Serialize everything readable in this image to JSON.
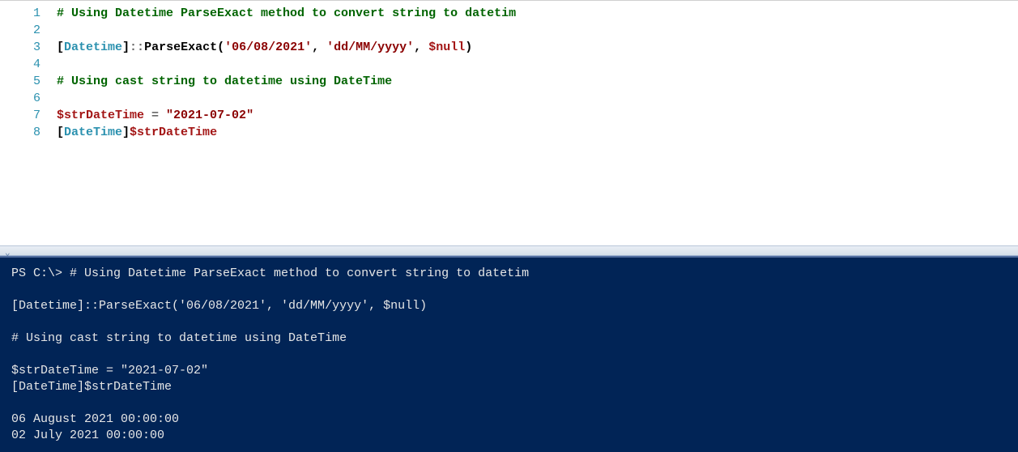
{
  "editor": {
    "line_numbers": [
      "1",
      "2",
      "3",
      "4",
      "5",
      "6",
      "7",
      "8"
    ],
    "lines": {
      "l1_comment": "# Using Datetime ParseExact method to convert string to datetim",
      "l3_open": "[",
      "l3_type": "Datetime",
      "l3_close": "]",
      "l3_scope": "::",
      "l3_method": "ParseExact",
      "l3_paren_o": "(",
      "l3_arg1": "'06/08/2021'",
      "l3_comma1": ", ",
      "l3_arg2": "'dd/MM/yyyy'",
      "l3_comma2": ", ",
      "l3_arg3": "$null",
      "l3_paren_c": ")",
      "l5_comment": "# Using cast string to datetime using DateTime",
      "l7_var": "$strDateTime",
      "l7_eq": " = ",
      "l7_str": "\"2021-07-02\"",
      "l8_open": "[",
      "l8_type": "DateTime",
      "l8_close": "]",
      "l8_var": "$strDateTime"
    }
  },
  "console": {
    "prompt": "PS C:\\> ",
    "c1": "# Using Datetime ParseExact method to convert string to datetim",
    "c2": "[Datetime]::ParseExact('06/08/2021', 'dd/MM/yyyy', $null)",
    "c3": "# Using cast string to datetime using DateTime",
    "c4": "$strDateTime = \"2021-07-02\"",
    "c5": "[DateTime]$strDateTime",
    "out1": "06 August 2021 00:00:00",
    "out2": "02 July 2021 00:00:00"
  }
}
